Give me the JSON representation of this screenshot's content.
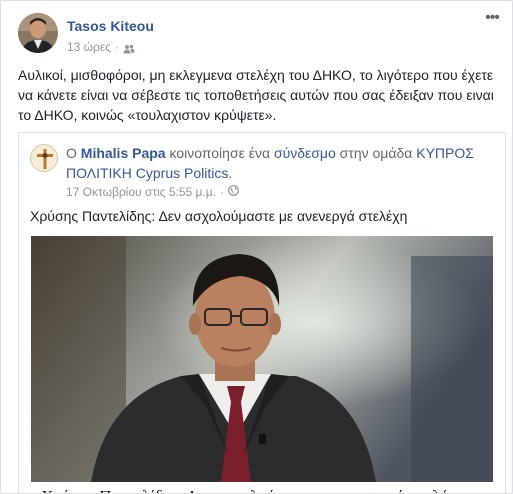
{
  "post": {
    "author": "Tasos Kiteou",
    "time": "13 ώρες",
    "separator": "·",
    "audience_icon": "friends-icon",
    "options_label": "•••",
    "text": "Αυλικοί, μισθοφόροι, μη εκλεγμενα στελέχη του ΔΗΚΟ, το λιγότερο που έχετε να κάνετε είναι να σέβεστε τις τοποθετήσεις αυτών που σας έδειξαν που ειναι το ΔΗΚΟ, κοινώς «τουλαχιστον κρύψετε»."
  },
  "shared": {
    "prefix": "Ο ",
    "author": "Mihalis Papa",
    "action": " κοινοποίησε ένα ",
    "link_word": "σύνδεσμο",
    "in_group": " στην ομάδα ",
    "group": "ΚΥΠΡΟΣ ΠΟΛΙΤΙΚΗ Cyprus Politics",
    "period": ".",
    "time": "17 Οκτωβρίου στις 5:55 μ.μ.",
    "separator": "·",
    "audience_icon": "globe-icon",
    "text": "Χρύσης Παντελίδης: Δεν ασχολούμαστε με ανενεργά στελέχη",
    "link_title": "Χρύσης Παντελίδης: Δεν ασχολούμαστε με ανενεργά στελέχη"
  },
  "colors": {
    "link": "#365899",
    "text": "#1d2129",
    "meta": "#90949c",
    "border": "#dddfe2"
  }
}
